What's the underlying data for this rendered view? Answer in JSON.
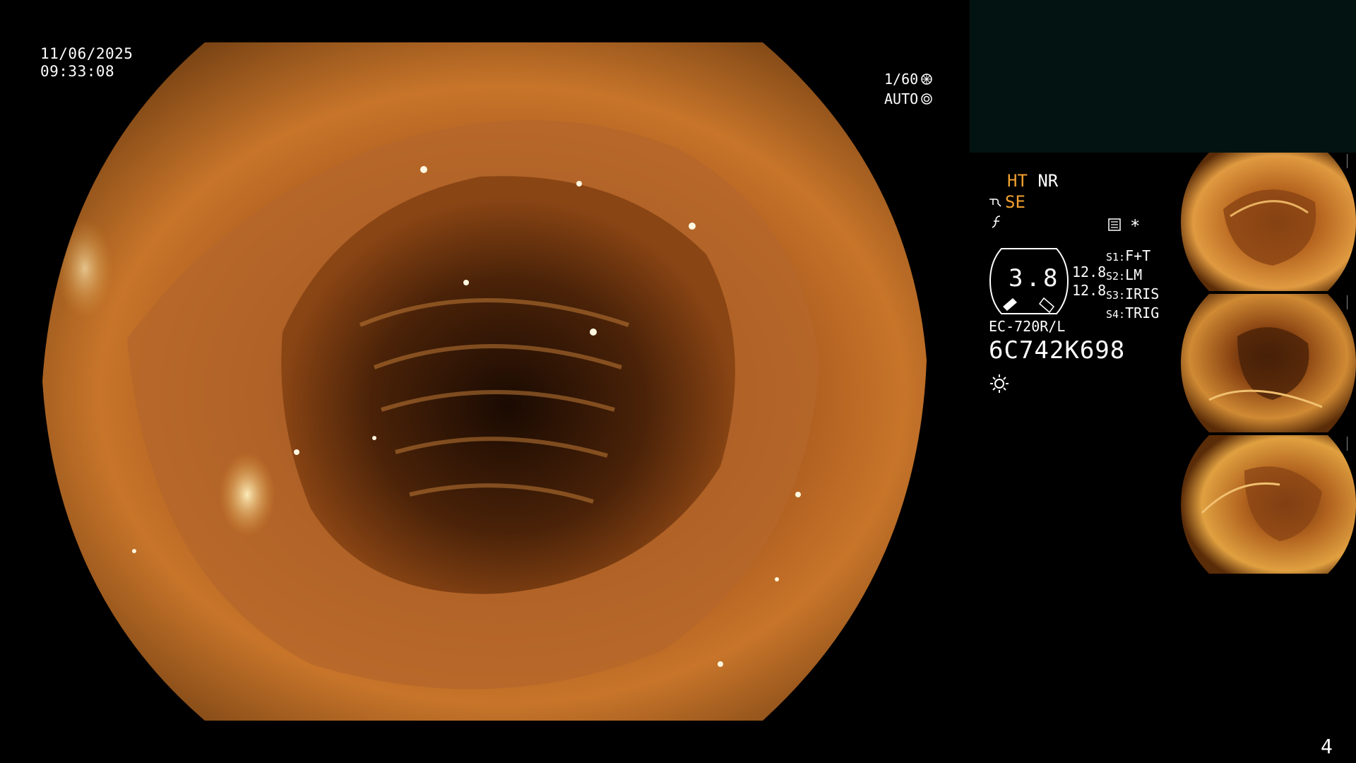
{
  "overlay": {
    "date": "11/06/2025",
    "time": "09:33:08",
    "shutter": "1/60",
    "exposure_mode": "AUTO"
  },
  "settings": {
    "ht": "HT",
    "nr": "NR",
    "se": "SE",
    "gauge_value": "3.8",
    "num_top": "12.8",
    "num_bottom": "12.8",
    "switches": [
      {
        "key": "S1:",
        "value": "F+T"
      },
      {
        "key": "S2:",
        "value": "LM"
      },
      {
        "key": "S3:",
        "value": "IRIS"
      },
      {
        "key": "S4:",
        "value": "TRIG"
      }
    ],
    "scope_model": "EC-720R/L",
    "serial": "6C742K698",
    "star": "*"
  },
  "icons": {
    "shutter": "aperture-icon",
    "auto": "auto-exposure-icon",
    "enhance": "structure-enhance-icon",
    "freeze": "freeze-icon",
    "memo": "memo-icon",
    "light": "light-source-icon"
  },
  "colors": {
    "orange_text": "#f0a030",
    "panel_bg": "#031312"
  },
  "page_number": "4"
}
